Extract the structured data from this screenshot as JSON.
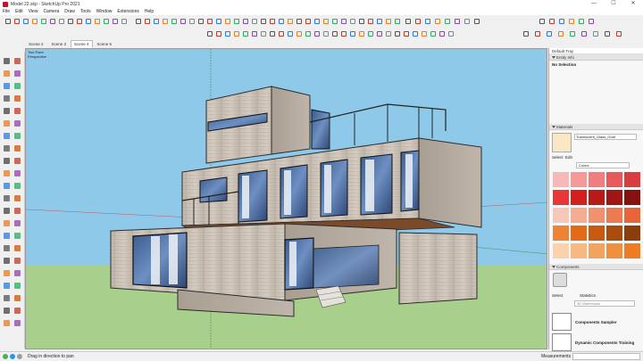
{
  "window": {
    "title": "Model 22.skp - SketchUp Pro 2021",
    "controls": [
      "—",
      "☐",
      "✕"
    ]
  },
  "menu": [
    "File",
    "Edit",
    "View",
    "Camera",
    "Draw",
    "Tools",
    "Window",
    "Extensions",
    "Help"
  ],
  "scenes": {
    "tabs": [
      {
        "label": "Scene 2",
        "active": false
      },
      {
        "label": "Scene 3",
        "active": false
      },
      {
        "label": "Scene 4",
        "active": true
      },
      {
        "label": "Scene 5",
        "active": false
      }
    ]
  },
  "viewport": {
    "camera_label": "Two Point",
    "view_label": "Perspective",
    "sky_color": "#8ec9ea",
    "ground_color": "#a8cf8c"
  },
  "tray": {
    "title": "Default Tray",
    "entity_info": {
      "header": "Entity Info",
      "selection": "No Selection"
    },
    "materials": {
      "header": "Materials",
      "current": "Translucent_Glass_Gold",
      "current_color": "#f9e7c6",
      "tabs": [
        "Select",
        "Edit"
      ],
      "library": "Colors",
      "swatches": [
        "#f7b8b8",
        "#f49a9a",
        "#f17e7e",
        "#e85a5a",
        "#d93d3d",
        "#e93737",
        "#d41f1f",
        "#b81a1a",
        "#a01515",
        "#861111",
        "#f6c8b6",
        "#f4ad92",
        "#f0926f",
        "#ec7a52",
        "#e86538",
        "#f08236",
        "#e36b17",
        "#c75a10",
        "#a84c0d",
        "#8a3e0a",
        "#fbd2a9",
        "#f8b981",
        "#f4a35d",
        "#f08f3e",
        "#ec7d25"
      ]
    },
    "components": {
      "header": "Components",
      "tabs": [
        "Select",
        "Statistics"
      ],
      "search_placeholder": "3D Warehouse",
      "items": [
        {
          "label": "Components Sampler"
        },
        {
          "label": "Dynamic Components Training"
        }
      ]
    }
  },
  "status": {
    "hint": "Drag in direction to pan",
    "measurements_label": "Measurements",
    "icon_colors": [
      "#4caf50",
      "#2196f3",
      "#9e9e9e"
    ]
  }
}
